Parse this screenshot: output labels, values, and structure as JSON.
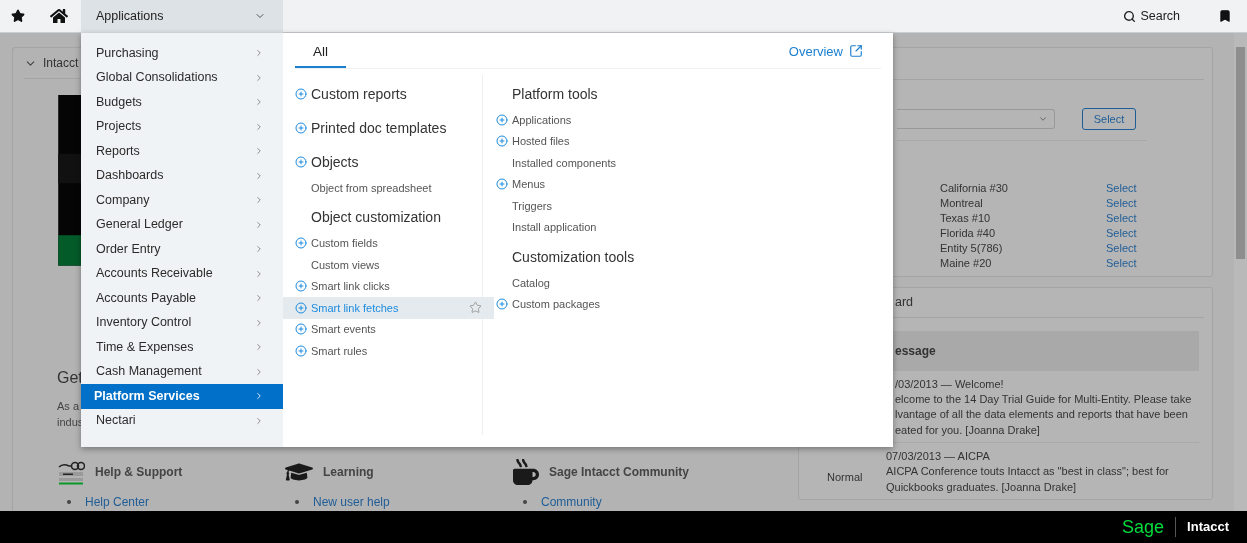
{
  "topbar": {
    "applications_label": "Applications",
    "search_label": "Search"
  },
  "apps_menu": {
    "items": [
      {
        "label": "Purchasing",
        "selected": false
      },
      {
        "label": "Global Consolidations",
        "selected": false
      },
      {
        "label": "Budgets",
        "selected": false
      },
      {
        "label": "Projects",
        "selected": false
      },
      {
        "label": "Reports",
        "selected": false
      },
      {
        "label": "Dashboards",
        "selected": false
      },
      {
        "label": "Company",
        "selected": false
      },
      {
        "label": "General Ledger",
        "selected": false
      },
      {
        "label": "Order Entry",
        "selected": false
      },
      {
        "label": "Accounts Receivable",
        "selected": false
      },
      {
        "label": "Accounts Payable",
        "selected": false
      },
      {
        "label": "Inventory Control",
        "selected": false
      },
      {
        "label": "Time & Expenses",
        "selected": false
      },
      {
        "label": "Cash Management",
        "selected": false
      },
      {
        "label": "Platform Services",
        "selected": true
      },
      {
        "label": "Nectari",
        "selected": false
      }
    ],
    "tabs": [
      {
        "label": "All",
        "selected": true
      }
    ],
    "overview_link": "Overview",
    "columns": [
      [
        {
          "kind": "section",
          "label": "Custom reports",
          "plus": true
        },
        {
          "kind": "section",
          "label": "Printed doc templates",
          "plus": true
        },
        {
          "kind": "section",
          "label": "Objects",
          "plus": true
        },
        {
          "kind": "link",
          "label": "Object from spreadsheet",
          "plus": false,
          "highlighted": false
        },
        {
          "kind": "section",
          "label": "Object customization",
          "plus": false
        },
        {
          "kind": "link",
          "label": "Custom fields",
          "plus": true,
          "highlighted": false
        },
        {
          "kind": "link",
          "label": "Custom views",
          "plus": false,
          "highlighted": false
        },
        {
          "kind": "link",
          "label": "Smart link clicks",
          "plus": true,
          "highlighted": false
        },
        {
          "kind": "link",
          "label": "Smart link fetches",
          "plus": true,
          "highlighted": true
        },
        {
          "kind": "link",
          "label": "Smart events",
          "plus": true,
          "highlighted": false
        },
        {
          "kind": "link",
          "label": "Smart rules",
          "plus": true,
          "highlighted": false
        }
      ],
      [
        {
          "kind": "section",
          "label": "Platform tools",
          "plus": false
        },
        {
          "kind": "link",
          "label": "Applications",
          "plus": true,
          "highlighted": false
        },
        {
          "kind": "link",
          "label": "Hosted files",
          "plus": true,
          "highlighted": false
        },
        {
          "kind": "link",
          "label": "Installed components",
          "plus": false,
          "highlighted": false
        },
        {
          "kind": "link",
          "label": "Menus",
          "plus": true,
          "highlighted": false
        },
        {
          "kind": "link",
          "label": "Triggers",
          "plus": false,
          "highlighted": false
        },
        {
          "kind": "link",
          "label": "Install application",
          "plus": false,
          "highlighted": false
        },
        {
          "kind": "section",
          "label": "Customization tools",
          "plus": false
        },
        {
          "kind": "link",
          "label": "Catalog",
          "plus": false,
          "highlighted": false
        },
        {
          "kind": "link",
          "label": "Custom packages",
          "plus": true,
          "highlighted": false
        }
      ]
    ]
  },
  "left_card": {
    "title": "Intacct",
    "heading": "Get",
    "text_lines": [
      "As a",
      "indus"
    ],
    "help_sections": [
      {
        "kind": "support",
        "title": "Help & Support",
        "links": [
          "Help Center"
        ]
      },
      {
        "kind": "learning",
        "title": "Learning",
        "links": [
          "New user help"
        ]
      },
      {
        "kind": "community",
        "title": "Sage Intacct Community",
        "links": [
          "Community"
        ]
      }
    ]
  },
  "entity_card": {
    "button": "Select",
    "entities": [
      {
        "name": "California #30",
        "action": "Select"
      },
      {
        "name": "Montreal",
        "action": "Select"
      },
      {
        "name": "Texas #10",
        "action": "Select"
      },
      {
        "name": "Florida #40",
        "action": "Select"
      },
      {
        "name": "Entity 5(786)",
        "action": "Select"
      },
      {
        "name": "Maine #20",
        "action": "Select"
      }
    ]
  },
  "message_card": {
    "title": "ard",
    "column_header": "essage",
    "messages": [
      {
        "header": "/03/2013 — Welcome!",
        "body_lines": [
          "elcome to the 14 Day Trial Guide for Multi-Entity. Please take",
          "lvantage of all the data elements and reports that have been",
          "eated for you. [Joanna Drake]"
        ]
      },
      {
        "priority": "Normal",
        "header": "07/03/2013 — AICPA",
        "body_lines": [
          "AICPA Conference touts Intacct as \"best in class\"; best for",
          "Quickbooks graduates. [Joanna Drake]"
        ]
      }
    ]
  },
  "footer": {
    "brand": "Sage",
    "product": "Intacct"
  }
}
